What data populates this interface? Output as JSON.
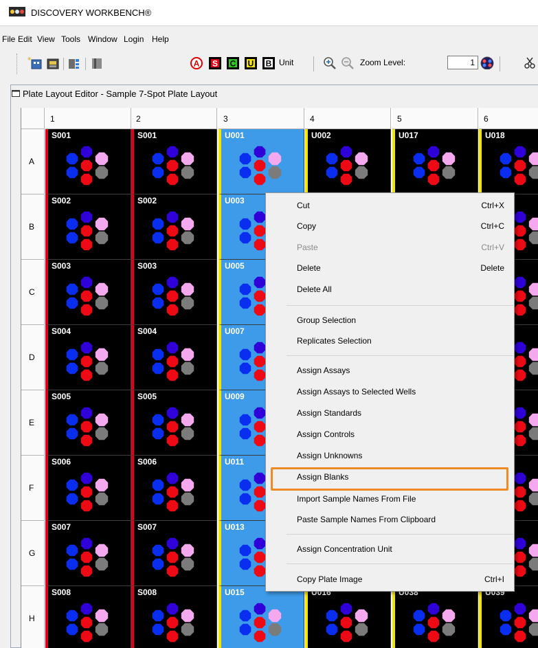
{
  "window": {
    "title": "DISCOVERY WORKBENCH®"
  },
  "menu": [
    "File",
    "Edit",
    "View",
    "Tools",
    "Window",
    "Login",
    "Help"
  ],
  "toolbar": {
    "badges": [
      {
        "letter": "A",
        "name": "assays-toolbar-icon"
      },
      {
        "letter": "S",
        "name": "standards-toolbar-icon"
      },
      {
        "letter": "C",
        "name": "controls-toolbar-icon"
      },
      {
        "letter": "U",
        "name": "unknowns-toolbar-icon"
      },
      {
        "letter": "B",
        "name": "blanks-toolbar-icon"
      }
    ],
    "unit_label": "Unit",
    "zoom_label": "Zoom Level:",
    "zoom_value": "1"
  },
  "editor": {
    "title": "Plate Layout Editor - Sample 7-Spot Plate Layout"
  },
  "plate": {
    "columns": [
      "1",
      "2",
      "3",
      "4",
      "5",
      "6"
    ],
    "rows": [
      "A",
      "B",
      "C",
      "D",
      "E",
      "F",
      "G",
      "H"
    ],
    "wells": [
      [
        "S001",
        "S001",
        "U001",
        "U002",
        "U017",
        "U018"
      ],
      [
        "S002",
        "S002",
        "U003",
        "",
        "",
        ""
      ],
      [
        "S003",
        "S003",
        "U005",
        "",
        "",
        ""
      ],
      [
        "S004",
        "S004",
        "U007",
        "",
        "",
        ""
      ],
      [
        "S005",
        "S005",
        "U009",
        "",
        "",
        ""
      ],
      [
        "S006",
        "S006",
        "U011",
        "",
        "",
        ""
      ],
      [
        "S007",
        "S007",
        "U013",
        "",
        "",
        ""
      ],
      [
        "S008",
        "S008",
        "U015",
        "U016",
        "U038",
        "U039"
      ]
    ],
    "selected_column": "3"
  },
  "colors": {
    "standard_stripe": "#e0001a",
    "unknown_stripe": "#f2e600",
    "selected_well": "#3d9be9",
    "well_background": "#000000",
    "spot_blue": "#0a2ef0",
    "spot_indigo": "#2f00d8",
    "spot_red": "#ee0a14",
    "spot_pink": "#f4a8ee",
    "spot_gray": "#7b7b7b",
    "highlight_box": "#f08a24"
  },
  "context_menu": {
    "items": [
      {
        "label": "Cut",
        "shortcut": "Ctrl+X",
        "enabled": true
      },
      {
        "label": "Copy",
        "shortcut": "Ctrl+C",
        "enabled": true
      },
      {
        "label": "Paste",
        "shortcut": "Ctrl+V",
        "enabled": false
      },
      {
        "label": "Delete",
        "shortcut": "Delete",
        "enabled": true
      },
      {
        "label": "Delete All",
        "shortcut": "",
        "enabled": true
      },
      {
        "label": "Group Selection",
        "shortcut": "",
        "enabled": true
      },
      {
        "label": "Replicates Selection",
        "shortcut": "",
        "enabled": true
      },
      {
        "label": "Assign Assays",
        "shortcut": "",
        "enabled": true
      },
      {
        "label": "Assign Assays to Selected Wells",
        "shortcut": "",
        "enabled": true
      },
      {
        "label": "Assign Standards",
        "shortcut": "",
        "enabled": true
      },
      {
        "label": "Assign Controls",
        "shortcut": "",
        "enabled": true
      },
      {
        "label": "Assign Unknowns",
        "shortcut": "",
        "enabled": true
      },
      {
        "label": "Assign Blanks",
        "shortcut": "",
        "enabled": true
      },
      {
        "label": "Import Sample Names From File",
        "shortcut": "",
        "enabled": true,
        "highlighted": true
      },
      {
        "label": "Paste Sample Names From Clipboard",
        "shortcut": "",
        "enabled": true
      },
      {
        "label": "Assign Concentration Unit",
        "shortcut": "",
        "enabled": true
      },
      {
        "label": "Copy Plate Image",
        "shortcut": "Ctrl+I",
        "enabled": true
      }
    ]
  }
}
